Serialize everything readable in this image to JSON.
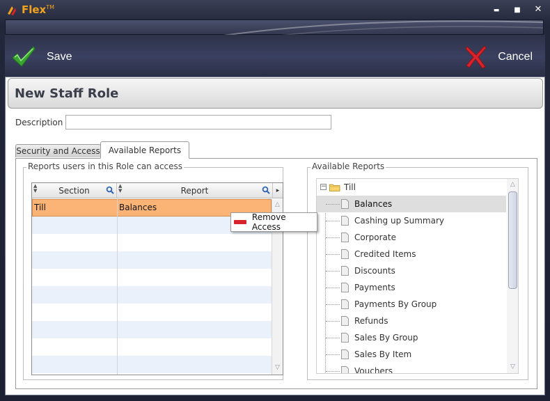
{
  "window": {
    "app_name": "Flex",
    "trademark": "TM",
    "minimize_glyph": "▬",
    "maximize_glyph": "■",
    "close_glyph": "✕"
  },
  "toolbar": {
    "save_label": "Save",
    "cancel_label": "Cancel"
  },
  "form": {
    "title": "New Staff Role",
    "description_label": "Description",
    "description_value": ""
  },
  "tabs": [
    {
      "label": "Security and Access",
      "active": false
    },
    {
      "label": "Available Reports",
      "active": true
    }
  ],
  "left_group": {
    "legend": "Reports users in this Role can access",
    "columns": [
      {
        "header": "Section"
      },
      {
        "header": "Report"
      }
    ],
    "rows": [
      {
        "section": "Till",
        "report": "Balances",
        "selected": true
      }
    ],
    "more_glyph": "▸"
  },
  "context_menu": {
    "items": [
      {
        "label": "Remove Access"
      }
    ]
  },
  "right_group": {
    "legend": "Available Reports",
    "tree": {
      "root": {
        "label": "Till",
        "expanded": true,
        "toggle_glyph": "−"
      },
      "children": [
        {
          "label": "Balances",
          "selected": true
        },
        {
          "label": "Cashing up Summary"
        },
        {
          "label": "Corporate"
        },
        {
          "label": "Credited Items"
        },
        {
          "label": "Discounts"
        },
        {
          "label": "Payments"
        },
        {
          "label": "Payments By Group"
        },
        {
          "label": "Refunds"
        },
        {
          "label": "Sales By Group"
        },
        {
          "label": "Sales By Item"
        },
        {
          "label": "Vouchers"
        }
      ]
    },
    "scroll_up_glyph": "△",
    "scroll_down_glyph": "▽"
  },
  "colors": {
    "accent_orange": "#f3a21c",
    "selected_row": "#fbb476",
    "save_check": "#3aa52e",
    "cancel_x": "#d9232a"
  },
  "icons": {
    "app": "flex-logo-icon",
    "save": "checkmark-icon",
    "cancel": "red-x-icon",
    "filter": "magnifier-icon",
    "remove": "remove-icon",
    "folder": "folder-icon",
    "document": "document-icon"
  }
}
